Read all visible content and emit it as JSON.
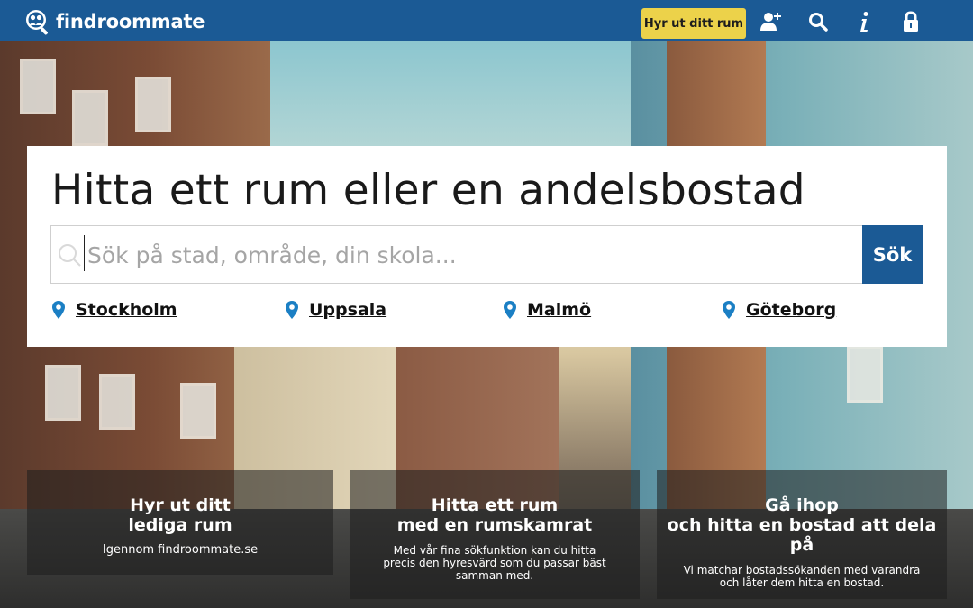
{
  "header": {
    "logo_text": "findroommate",
    "rent_button_label": "Hyr ut ditt rum",
    "accent_color": "#1b5a95",
    "button_color": "#ecd24a"
  },
  "hero": {
    "title": "Hitta ett rum eller en andelsbostad",
    "search": {
      "placeholder": "Sök på stad, område, din skola...",
      "value": "",
      "button_label": "Sök"
    },
    "cities": [
      {
        "label": "Stockholm"
      },
      {
        "label": "Uppsala"
      },
      {
        "label": "Malmö"
      },
      {
        "label": "Göteborg"
      }
    ]
  },
  "features": [
    {
      "title": "Hyr ut ditt\nlediga rum",
      "description": "Igennom findroommate.se"
    },
    {
      "title": "Hitta ett rum\nmed en rumskamrat",
      "description": "Med vår fina sökfunktion kan du hitta\nprecis den hyresvärd som du passar bäst\nsamman med."
    },
    {
      "title": "Gå ihop\noch hitta en bostad att dela\npå",
      "description": "Vi matchar bostadssökanden med varandra\noch låter dem hitta en bostad."
    }
  ]
}
